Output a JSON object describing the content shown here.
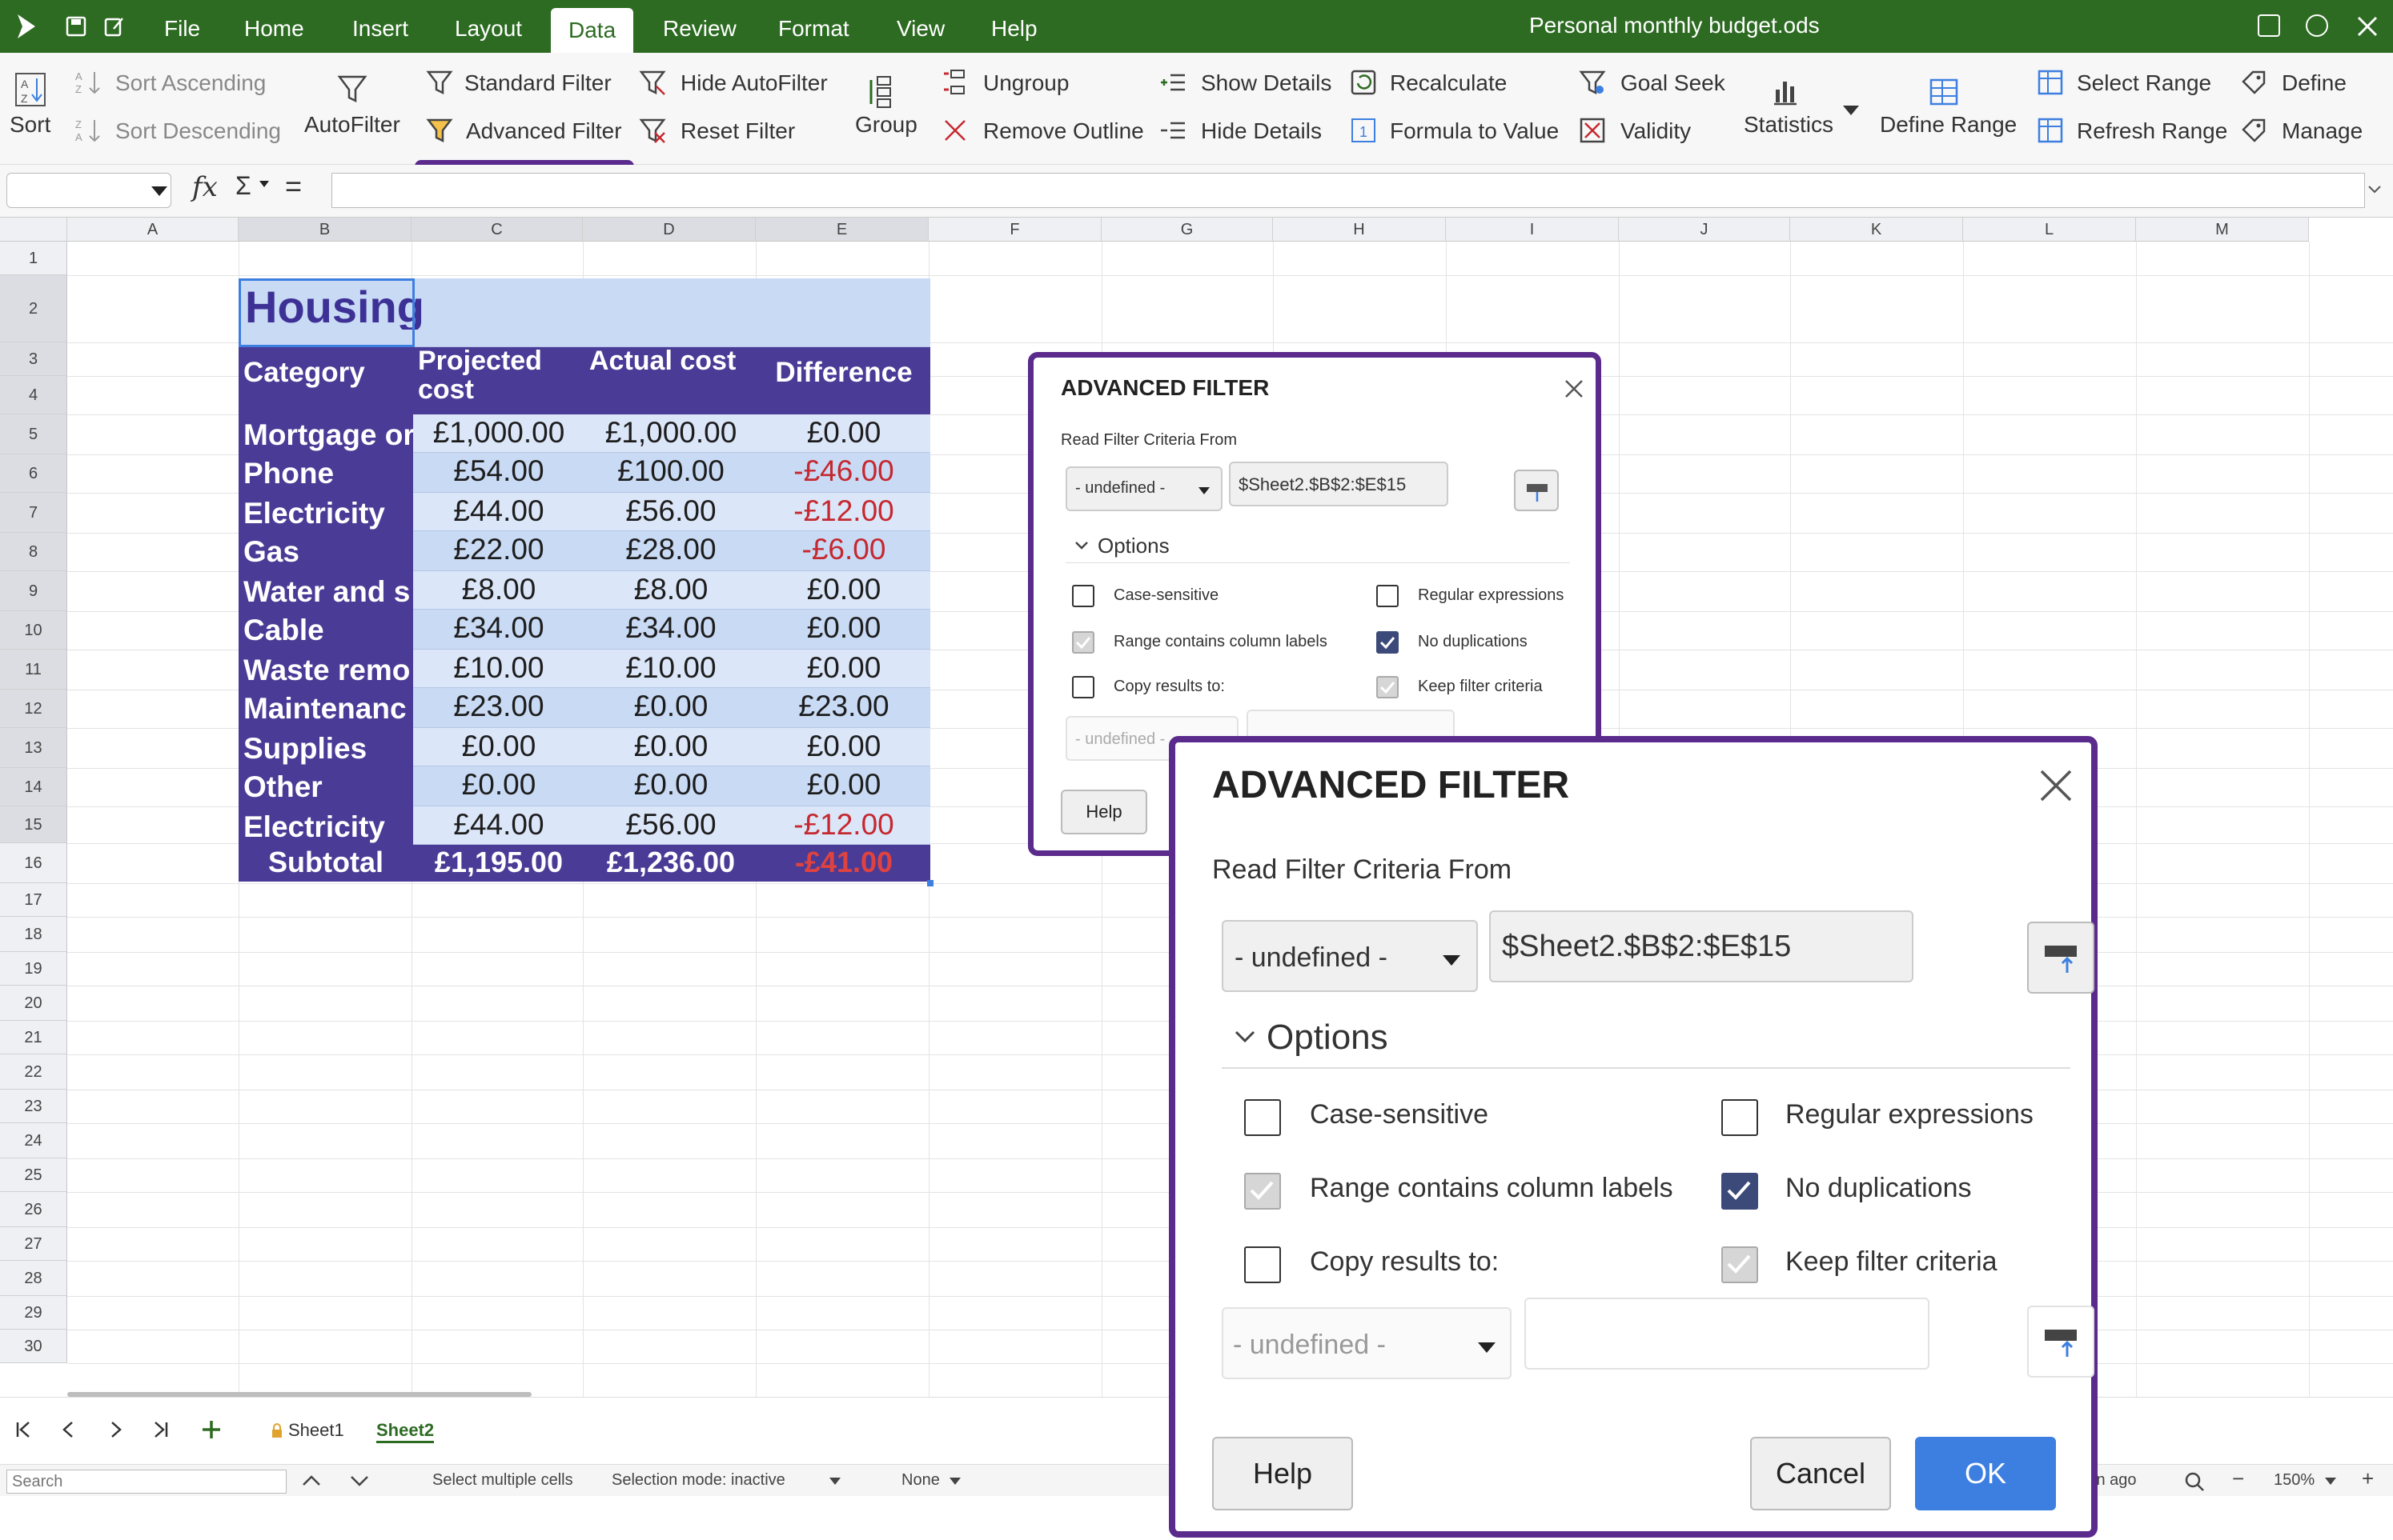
{
  "menubar": {
    "items": [
      "File",
      "Home",
      "Insert",
      "Layout",
      "Data",
      "Review",
      "Format",
      "View",
      "Help"
    ],
    "document_title": "Personal monthly budget.ods"
  },
  "toolbar": {
    "sort": "Sort",
    "sort_ascending": "Sort Ascending",
    "sort_descending": "Sort Descending",
    "autofilter": "AutoFilter",
    "standard_filter": "Standard Filter",
    "advanced_filter": "Advanced Filter",
    "hide_autofilter": "Hide AutoFilter",
    "reset_filter": "Reset Filter",
    "group": "Group",
    "ungroup": "Ungroup",
    "remove_outline": "Remove Outline",
    "show_details": "Show Details",
    "hide_details": "Hide Details",
    "recalculate": "Recalculate",
    "formula_to_value": "Formula to Value",
    "goal_seek": "Goal Seek",
    "validity": "Validity",
    "statistics": "Statistics",
    "define_range": "Define Range",
    "select_range": "Select Range",
    "refresh_range": "Refresh Range",
    "define": "Define",
    "manage": "Manage"
  },
  "formula_bar": {
    "fx": "fx",
    "sigma": "Σ",
    "equals": "=",
    "value": ""
  },
  "grid": {
    "columns": [
      "A",
      "B",
      "C",
      "D",
      "E",
      "F",
      "G",
      "H",
      "I",
      "J",
      "K",
      "L",
      "M"
    ],
    "rows": [
      "1",
      "2",
      "3",
      "4",
      "5",
      "6",
      "7",
      "8",
      "9",
      "10",
      "11",
      "12",
      "13",
      "14",
      "15",
      "16",
      "17",
      "18",
      "19",
      "20",
      "21",
      "22",
      "23",
      "24",
      "25",
      "26",
      "27",
      "28",
      "29",
      "30"
    ]
  },
  "table": {
    "title": "Housing",
    "headers": {
      "category": "Category",
      "projected": "Projected cost",
      "actual": "Actual cost",
      "difference": "Difference"
    },
    "rows": [
      {
        "category": "Mortgage or",
        "projected": "£1,000.00",
        "actual": "£1,000.00",
        "difference": "£0.00",
        "negative": false
      },
      {
        "category": "Phone",
        "projected": "£54.00",
        "actual": "£100.00",
        "difference": "-£46.00",
        "negative": true
      },
      {
        "category": "Electricity",
        "projected": "£44.00",
        "actual": "£56.00",
        "difference": "-£12.00",
        "negative": true
      },
      {
        "category": "Gas",
        "projected": "£22.00",
        "actual": "£28.00",
        "difference": "-£6.00",
        "negative": true
      },
      {
        "category": "Water and s",
        "projected": "£8.00",
        "actual": "£8.00",
        "difference": "£0.00",
        "negative": false
      },
      {
        "category": "Cable",
        "projected": "£34.00",
        "actual": "£34.00",
        "difference": "£0.00",
        "negative": false
      },
      {
        "category": "Waste remo",
        "projected": "£10.00",
        "actual": "£10.00",
        "difference": "£0.00",
        "negative": false
      },
      {
        "category": "Maintenanc",
        "projected": "£23.00",
        "actual": "£0.00",
        "difference": "£23.00",
        "negative": false
      },
      {
        "category": "Supplies",
        "projected": "£0.00",
        "actual": "£0.00",
        "difference": "£0.00",
        "negative": false
      },
      {
        "category": "Other",
        "projected": "£0.00",
        "actual": "£0.00",
        "difference": "£0.00",
        "negative": false
      },
      {
        "category": "Electricity",
        "projected": "£44.00",
        "actual": "£56.00",
        "difference": "-£12.00",
        "negative": true
      }
    ],
    "subtotal": {
      "label": "Subtotal",
      "projected": "£1,195.00",
      "actual": "£1,236.00",
      "difference": "-£41.00"
    }
  },
  "sheets": {
    "tabs": [
      "Sheet1",
      "Sheet2"
    ],
    "active": "Sheet2"
  },
  "statusbar": {
    "search_placeholder": "Search",
    "select_multiple": "Select multiple cells",
    "selection_mode": "Selection mode: inactive",
    "none": "None",
    "saved": "in ago",
    "zoom": "150%"
  },
  "dialog": {
    "title": "ADVANCED FILTER",
    "read_from": "Read Filter Criteria From",
    "source_select": "- undefined -",
    "source_range": "$Sheet2.$B$2:$E$15",
    "options_label": "Options",
    "case_sensitive": "Case-sensitive",
    "regular_expressions": "Regular expressions",
    "range_contains_labels": "Range contains column labels",
    "no_duplications": "No duplications",
    "copy_results": "Copy results to:",
    "keep_filter_criteria": "Keep filter criteria",
    "copy_select": "- undefined -",
    "copy_range": "",
    "help": "Help",
    "cancel": "Cancel",
    "ok": "OK"
  },
  "colors": {
    "menubar": "#2d6b22",
    "table_header": "#4a3b96",
    "table_fill": "#c9daf5",
    "highlight": "#5a2a8c",
    "ok_button": "#3d7fe0",
    "negative": "#c5282f"
  }
}
